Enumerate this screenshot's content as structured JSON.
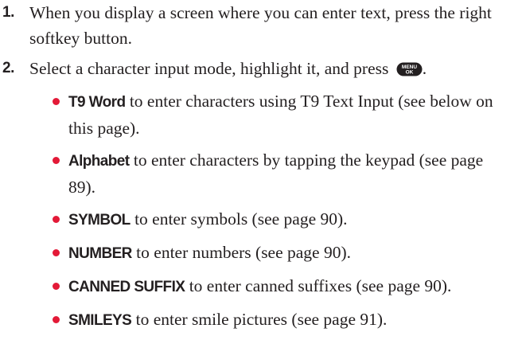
{
  "steps": [
    {
      "number": "1.",
      "text": "When you display a screen where you can enter text, press the right softkey button."
    },
    {
      "number": "2.",
      "text": "Select a character input mode, highlight it, and press ",
      "key_label_top": "MENU",
      "key_label_bottom": "OK",
      "text_after": "."
    }
  ],
  "options": [
    {
      "term": "T9 Word",
      "description": " to enter characters using T9 Text Input (see below on this page)."
    },
    {
      "term": "Alphabet",
      "description": " to enter characters by tapping the keypad (see page 89)."
    },
    {
      "term": "SYMBOL",
      "description": " to enter symbols (see page 90)."
    },
    {
      "term": "NUMBER",
      "description": " to enter numbers (see page 90)."
    },
    {
      "term": "CANNED SUFFIX",
      "description": " to enter canned suffixes (see page 90)."
    },
    {
      "term": "SMILEYS",
      "description": " to enter smile pictures (see page 91)."
    }
  ],
  "colors": {
    "text": "#231f20",
    "bullet": "#e31937",
    "key_fill": "#231f20",
    "key_text": "#ffffff"
  },
  "icons": {
    "menu_ok_key": "menu-ok-key-icon",
    "bullet": "red-bullet-dot"
  }
}
